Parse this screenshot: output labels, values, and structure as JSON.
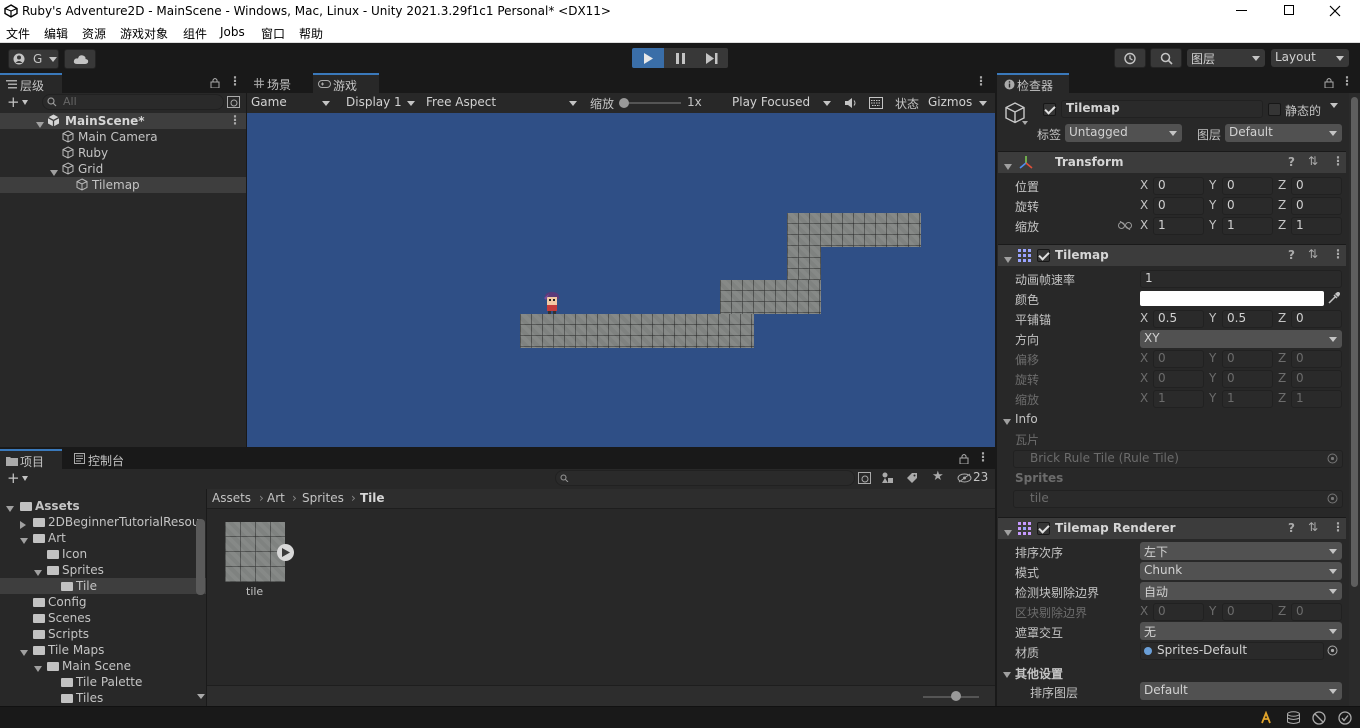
{
  "window": {
    "title": "Ruby's Adventure2D - MainScene - Windows, Mac, Linux - Unity 2021.3.29f1c1 Personal* <DX11>"
  },
  "menu": [
    "文件",
    "编辑",
    "资源",
    "游戏对象",
    "组件",
    "Jobs",
    "窗口",
    "帮助"
  ],
  "toolbar": {
    "account": "G",
    "layers": "图层",
    "layout": "Layout"
  },
  "hierarchy": {
    "tab": "层级",
    "search_placeholder": "All",
    "scene": "MainScene*",
    "items": [
      "Main Camera",
      "Ruby",
      "Grid",
      "Tilemap"
    ]
  },
  "game_view": {
    "tabs": [
      "场景",
      "游戏"
    ],
    "mode": "Game",
    "display": "Display 1",
    "aspect": "Free Aspect",
    "scale_label": "缩放",
    "scale_value": "1x",
    "play_mode": "Play Focused",
    "stats": "状态",
    "gizmos": "Gizmos",
    "background": "#2f4f86"
  },
  "project": {
    "tabs": [
      "项目",
      "控制台"
    ],
    "hidden_count": "23",
    "tree": [
      {
        "label": "Assets",
        "bold": true
      },
      {
        "label": "2DBeginnerTutorialResou"
      },
      {
        "label": "Art"
      },
      {
        "label": "Icon"
      },
      {
        "label": "Sprites"
      },
      {
        "label": "Tile"
      },
      {
        "label": "Config"
      },
      {
        "label": "Scenes"
      },
      {
        "label": "Scripts"
      },
      {
        "label": "Tile Maps"
      },
      {
        "label": "Main Scene"
      },
      {
        "label": "Tile Palette"
      },
      {
        "label": "Tiles"
      }
    ],
    "breadcrumb": [
      "Assets",
      "Art",
      "Sprites",
      "Tile"
    ],
    "asset": "tile"
  },
  "inspector": {
    "tab": "检查器",
    "object_name": "Tilemap",
    "static_label": "静态的",
    "tag_label": "标签",
    "tag_value": "Untagged",
    "layer_label": "图层",
    "layer_value": "Default",
    "transform": {
      "title": "Transform",
      "position_label": "位置",
      "rotation_label": "旋转",
      "scale_label": "缩放",
      "position": [
        "0",
        "0",
        "0"
      ],
      "rotation": [
        "0",
        "0",
        "0"
      ],
      "scale": [
        "1",
        "1",
        "1"
      ]
    },
    "tilemap": {
      "title": "Tilemap",
      "anim_rate_label": "动画帧速率",
      "anim_rate": "1",
      "color_label": "颜色",
      "color": "#ffffff",
      "anchor_label": "平铺锚",
      "anchor": [
        "0.5",
        "0.5",
        "0"
      ],
      "orientation_label": "方向",
      "orientation": "XY",
      "offset_label": "偏移",
      "offset": [
        "0",
        "0",
        "0"
      ],
      "rot_label": "旋转",
      "rot": [
        "0",
        "0",
        "0"
      ],
      "scl_label": "缩放",
      "scl": [
        "1",
        "1",
        "1"
      ],
      "info_label": "Info",
      "tiles_label": "瓦片",
      "tile_entry": "Brick Rule Tile (Rule Tile)",
      "sprites_label": "Sprites",
      "sprite_entry": "tile"
    },
    "renderer": {
      "title": "Tilemap Renderer",
      "sort_order_label": "排序次序",
      "sort_order": "左下",
      "mode_label": "模式",
      "mode": "Chunk",
      "detect_label": "检测块剔除边界",
      "detect": "自动",
      "chunk_label": "区块剔除边界",
      "chunk": [
        "0",
        "0",
        "0"
      ],
      "mask_label": "遮罩交互",
      "mask": "无",
      "material_label": "材质",
      "material": "Sprites-Default",
      "other_label": "其他设置",
      "sorting_layer_label": "排序图层",
      "sorting_layer": "Default"
    }
  },
  "axis": [
    "X",
    "Y",
    "Z"
  ]
}
